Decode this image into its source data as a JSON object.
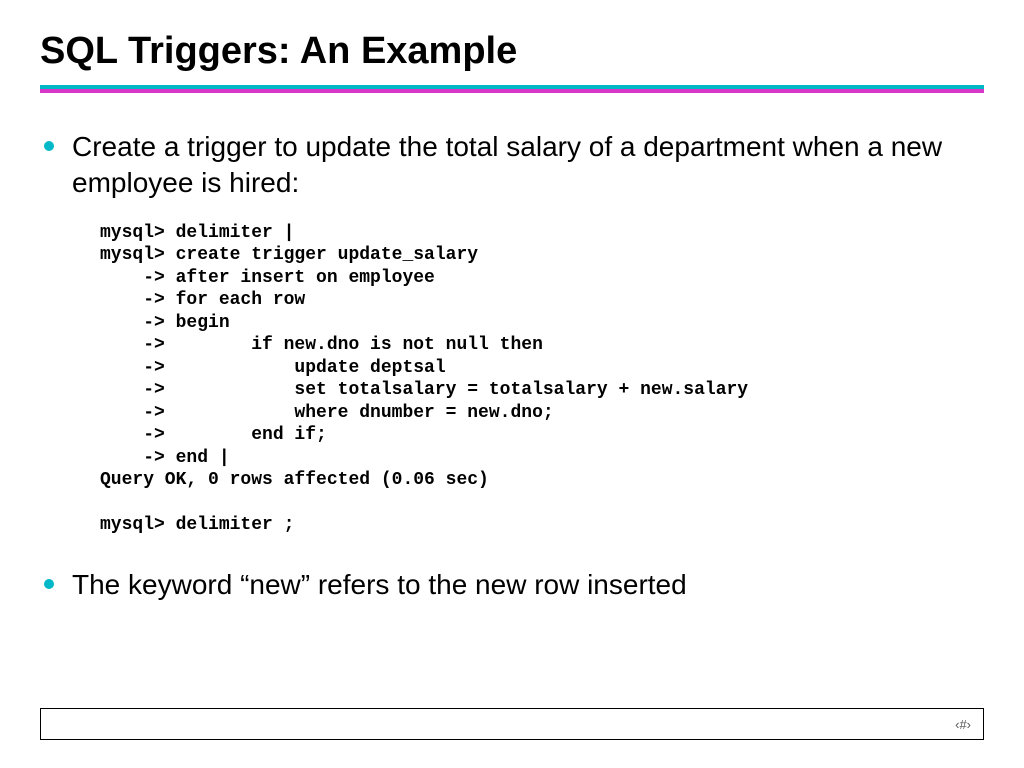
{
  "title": "SQL Triggers: An Example",
  "bullets": [
    "Create a trigger to update the total salary of a department when a new employee is hired:",
    "The keyword “new” refers to the new row inserted"
  ],
  "code": "mysql> delimiter |\nmysql> create trigger update_salary\n    -> after insert on employee\n    -> for each row\n    -> begin\n    ->        if new.dno is not null then\n    ->            update deptsal\n    ->            set totalsalary = totalsalary + new.salary\n    ->            where dnumber = new.dno;\n    ->        end if;\n    -> end |\nQuery OK, 0 rows affected (0.06 sec)\n\nmysql> delimiter ;",
  "footer": {
    "page": "‹#›"
  }
}
